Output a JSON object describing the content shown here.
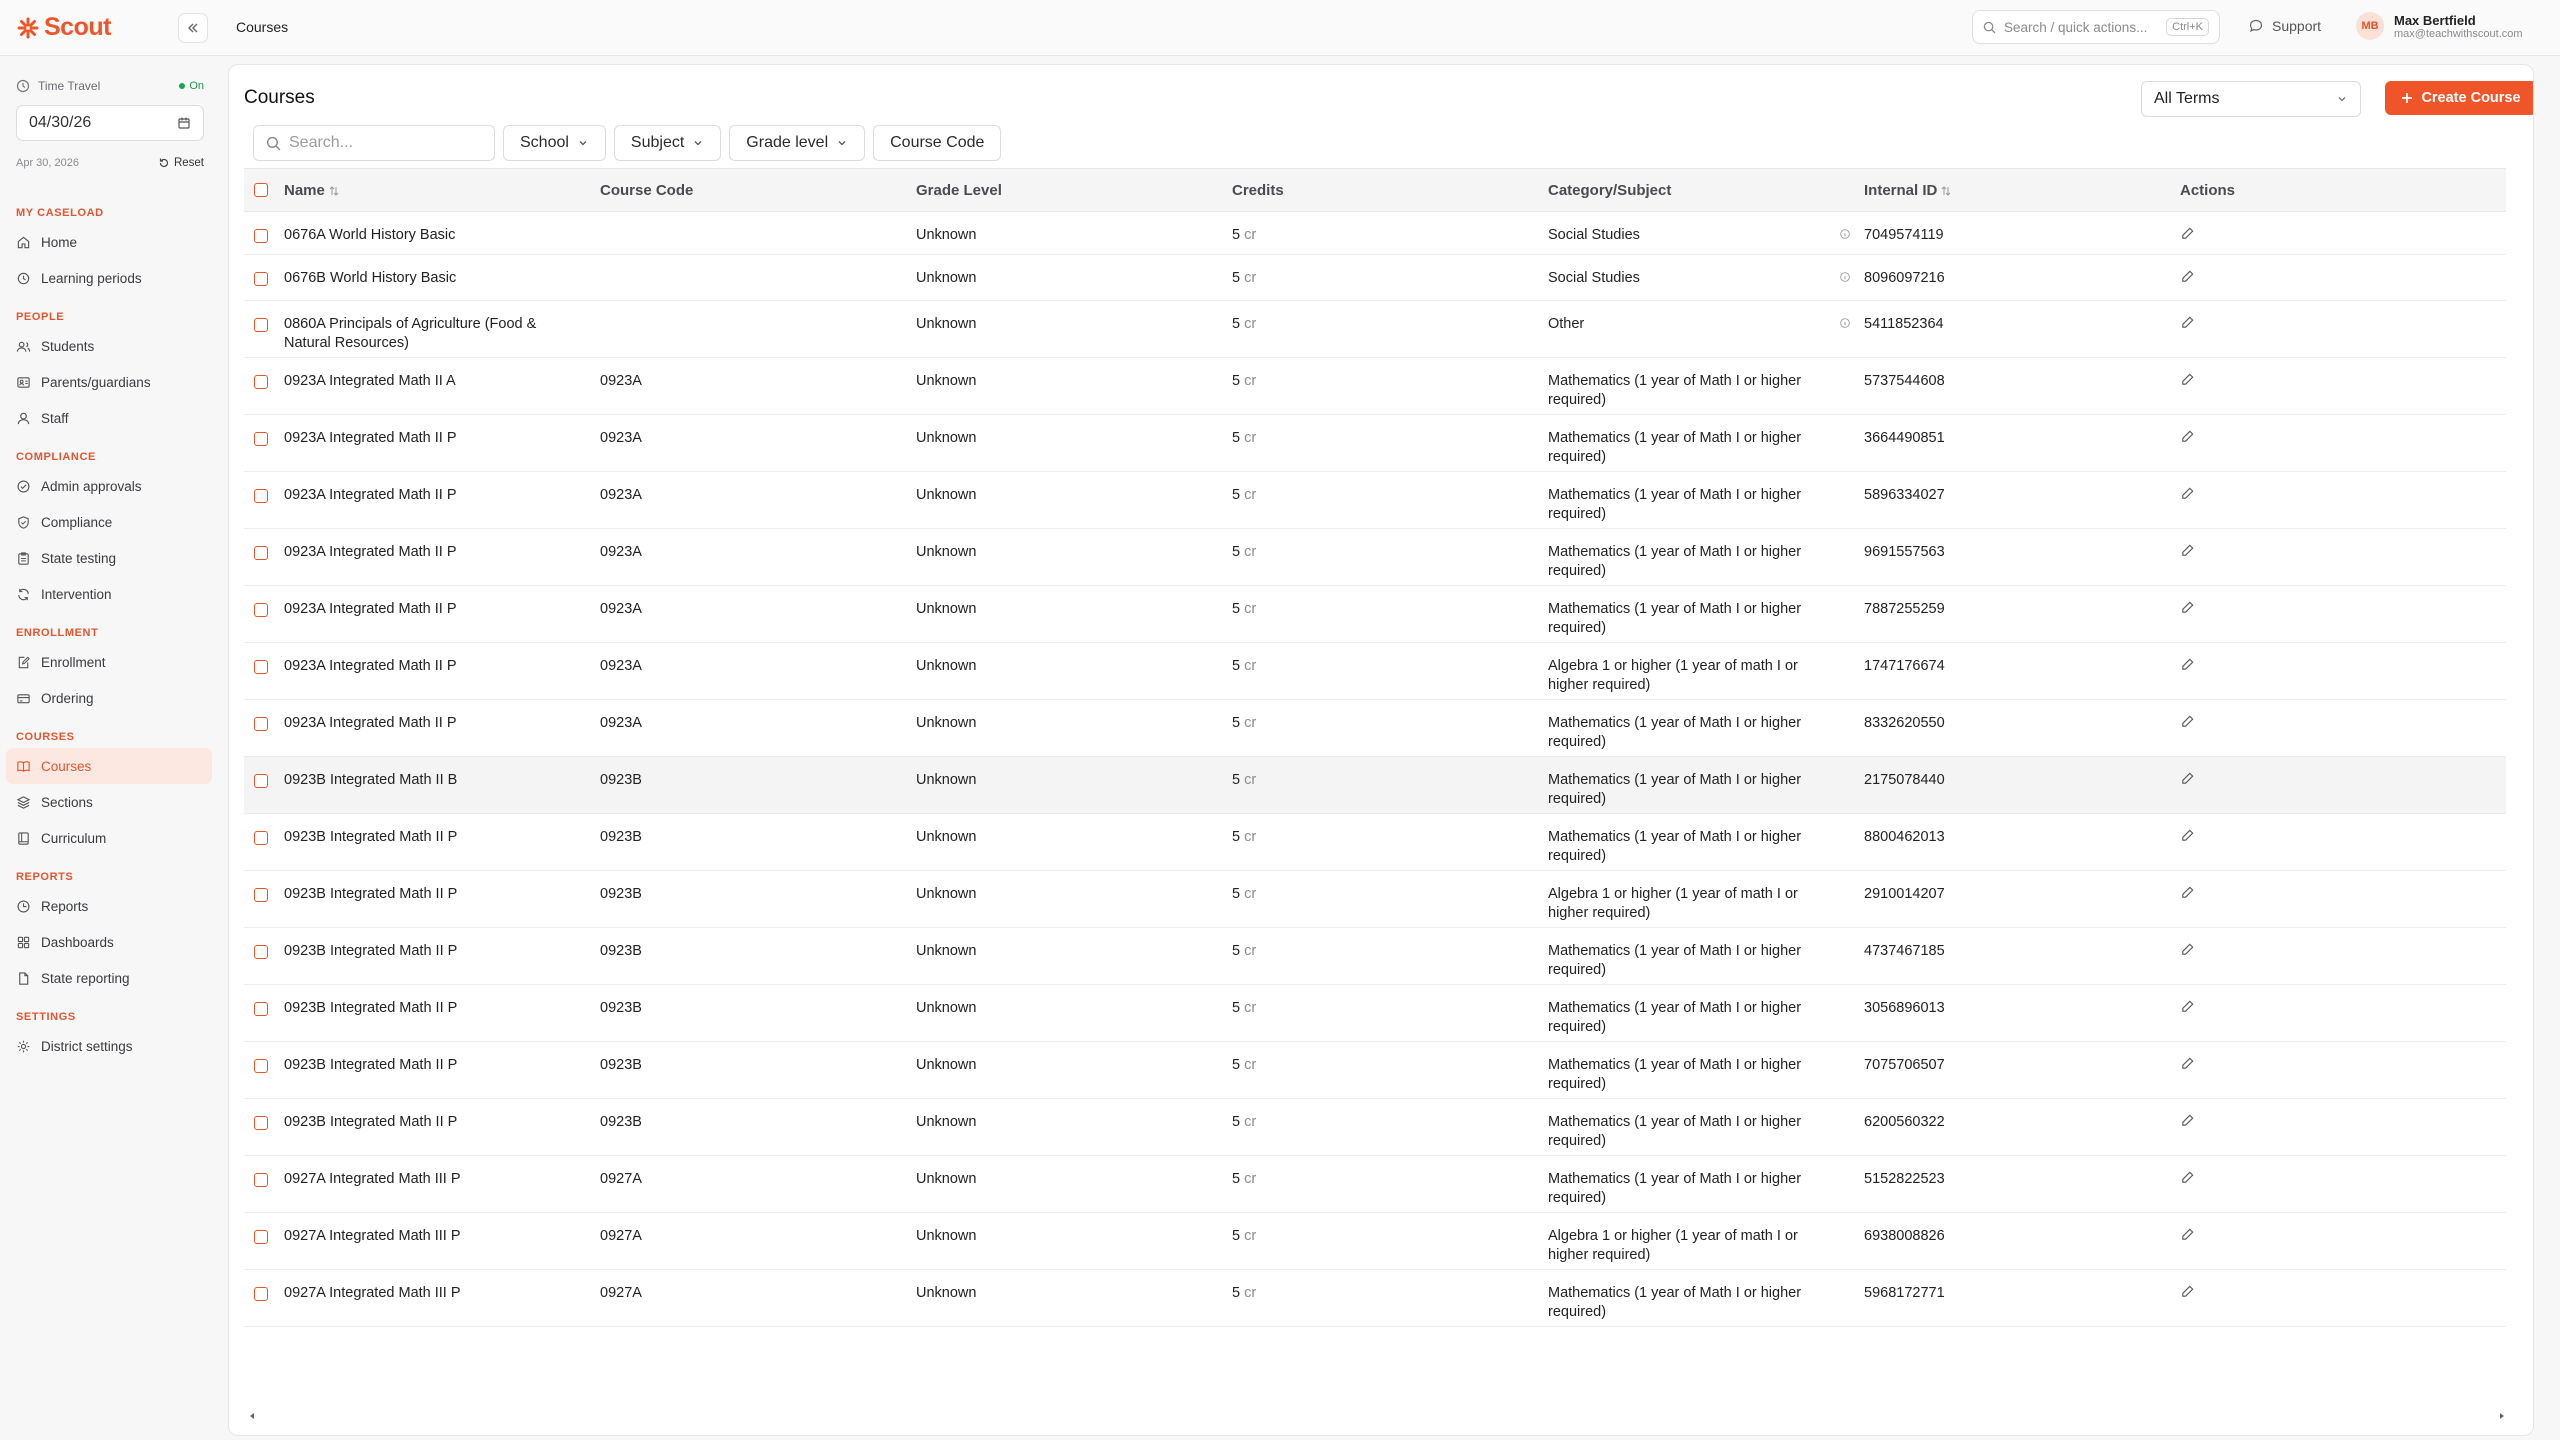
{
  "app": {
    "name": "Scout",
    "accent": "#f0552a"
  },
  "topbar": {
    "breadcrumb": "Courses",
    "search_placeholder": "Search / quick actions...",
    "search_shortcut": "Ctrl+K",
    "support": "Support",
    "user": {
      "initials": "MB",
      "name": "Max Bertfield",
      "email": "max@teachwithscout.com"
    }
  },
  "sidebar": {
    "time_travel": {
      "label": "Time Travel",
      "status": "On",
      "date": "04/30/26",
      "date_long": "Apr 30, 2026",
      "reset": "Reset"
    },
    "sections": [
      {
        "title": "MY CASELOAD",
        "items": [
          {
            "label": "Home",
            "icon": "home-icon"
          },
          {
            "label": "Learning periods",
            "icon": "clock-icon"
          }
        ]
      },
      {
        "title": "PEOPLE",
        "items": [
          {
            "label": "Students",
            "icon": "users-icon"
          },
          {
            "label": "Parents/guardians",
            "icon": "contact-card-icon"
          },
          {
            "label": "Staff",
            "icon": "user-icon"
          }
        ]
      },
      {
        "title": "COMPLIANCE",
        "items": [
          {
            "label": "Admin approvals",
            "icon": "check-circle-icon"
          },
          {
            "label": "Compliance",
            "icon": "shield-icon"
          },
          {
            "label": "State testing",
            "icon": "clipboard-icon"
          },
          {
            "label": "Intervention",
            "icon": "refresh-icon"
          }
        ]
      },
      {
        "title": "ENROLLMENT",
        "items": [
          {
            "label": "Enrollment",
            "icon": "edit-doc-icon"
          },
          {
            "label": "Ordering",
            "icon": "card-icon"
          }
        ]
      },
      {
        "title": "COURSES",
        "items": [
          {
            "label": "Courses",
            "icon": "book-icon",
            "active": true
          },
          {
            "label": "Sections",
            "icon": "layers-icon"
          },
          {
            "label": "Curriculum",
            "icon": "notebook-icon"
          }
        ]
      },
      {
        "title": "REPORTS",
        "items": [
          {
            "label": "Reports",
            "icon": "chart-clock-icon"
          },
          {
            "label": "Dashboards",
            "icon": "grid-icon"
          },
          {
            "label": "State reporting",
            "icon": "file-icon"
          }
        ]
      },
      {
        "title": "SETTINGS",
        "items": [
          {
            "label": "District settings",
            "icon": "gear-icon"
          }
        ]
      }
    ]
  },
  "main": {
    "title": "Courses",
    "terms_select": "All Terms",
    "create_button": "Create Course",
    "search_placeholder": "Search...",
    "filters": [
      "School",
      "Subject",
      "Grade level",
      "Course Code"
    ],
    "columns": [
      "Name",
      "Course Code",
      "Grade Level",
      "Credits",
      "Category/Subject",
      "Internal ID",
      "Actions"
    ],
    "rows": [
      {
        "name": "0676A World History Basic",
        "code": "",
        "grade": "Unknown",
        "credits": "5",
        "unit": "cr",
        "category": "Social Studies",
        "info": true,
        "id": "7049574119"
      },
      {
        "name": "0676B World History Basic",
        "code": "",
        "grade": "Unknown",
        "credits": "5",
        "unit": "cr",
        "category": "Social Studies",
        "info": true,
        "id": "8096097216"
      },
      {
        "name": "0860A Principals of Agriculture (Food & Natural Resources)",
        "code": "",
        "grade": "Unknown",
        "credits": "5",
        "unit": "cr",
        "category": "Other",
        "info": true,
        "id": "5411852364"
      },
      {
        "name": "0923A Integrated Math II A",
        "code": "0923A",
        "grade": "Unknown",
        "credits": "5",
        "unit": "cr",
        "category": "Mathematics (1 year of Math I or higher required)",
        "id": "5737544608"
      },
      {
        "name": "0923A Integrated Math II P",
        "code": "0923A",
        "grade": "Unknown",
        "credits": "5",
        "unit": "cr",
        "category": "Mathematics (1 year of Math I or higher required)",
        "id": "3664490851"
      },
      {
        "name": "0923A Integrated Math II P",
        "code": "0923A",
        "grade": "Unknown",
        "credits": "5",
        "unit": "cr",
        "category": "Mathematics (1 year of Math I or higher required)",
        "id": "5896334027"
      },
      {
        "name": "0923A Integrated Math II P",
        "code": "0923A",
        "grade": "Unknown",
        "credits": "5",
        "unit": "cr",
        "category": "Mathematics (1 year of Math I or higher required)",
        "id": "9691557563"
      },
      {
        "name": "0923A Integrated Math II P",
        "code": "0923A",
        "grade": "Unknown",
        "credits": "5",
        "unit": "cr",
        "category": "Mathematics (1 year of Math I or higher required)",
        "id": "7887255259"
      },
      {
        "name": "0923A Integrated Math II P",
        "code": "0923A",
        "grade": "Unknown",
        "credits": "5",
        "unit": "cr",
        "category": "Algebra 1 or higher (1 year of math I or higher required)",
        "id": "1747176674"
      },
      {
        "name": "0923A Integrated Math II P",
        "code": "0923A",
        "grade": "Unknown",
        "credits": "5",
        "unit": "cr",
        "category": "Mathematics (1 year of Math I or higher required)",
        "id": "8332620550"
      },
      {
        "name": "0923B Integrated Math II B",
        "code": "0923B",
        "grade": "Unknown",
        "credits": "5",
        "unit": "cr",
        "category": "Mathematics (1 year of Math I or higher required)",
        "id": "2175078440",
        "highlight": true
      },
      {
        "name": "0923B Integrated Math II P",
        "code": "0923B",
        "grade": "Unknown",
        "credits": "5",
        "unit": "cr",
        "category": "Mathematics (1 year of Math I or higher required)",
        "id": "8800462013"
      },
      {
        "name": "0923B Integrated Math II P",
        "code": "0923B",
        "grade": "Unknown",
        "credits": "5",
        "unit": "cr",
        "category": "Algebra 1 or higher (1 year of math I or higher required)",
        "id": "2910014207"
      },
      {
        "name": "0923B Integrated Math II P",
        "code": "0923B",
        "grade": "Unknown",
        "credits": "5",
        "unit": "cr",
        "category": "Mathematics (1 year of Math I or higher required)",
        "id": "4737467185"
      },
      {
        "name": "0923B Integrated Math II P",
        "code": "0923B",
        "grade": "Unknown",
        "credits": "5",
        "unit": "cr",
        "category": "Mathematics (1 year of Math I or higher required)",
        "id": "3056896013"
      },
      {
        "name": "0923B Integrated Math II P",
        "code": "0923B",
        "grade": "Unknown",
        "credits": "5",
        "unit": "cr",
        "category": "Mathematics (1 year of Math I or higher required)",
        "id": "7075706507"
      },
      {
        "name": "0923B Integrated Math II P",
        "code": "0923B",
        "grade": "Unknown",
        "credits": "5",
        "unit": "cr",
        "category": "Mathematics (1 year of Math I or higher required)",
        "id": "6200560322"
      },
      {
        "name": "0927A Integrated Math III P",
        "code": "0927A",
        "grade": "Unknown",
        "credits": "5",
        "unit": "cr",
        "category": "Mathematics (1 year of Math I or higher required)",
        "id": "5152822523"
      },
      {
        "name": "0927A Integrated Math III P",
        "code": "0927A",
        "grade": "Unknown",
        "credits": "5",
        "unit": "cr",
        "category": "Algebra 1 or higher (1 year of math I or higher required)",
        "id": "6938008826"
      },
      {
        "name": "0927A Integrated Math III P",
        "code": "0927A",
        "grade": "Unknown",
        "credits": "5",
        "unit": "cr",
        "category": "Mathematics (1 year of Math I or higher required)",
        "id": "5968172771"
      }
    ]
  }
}
